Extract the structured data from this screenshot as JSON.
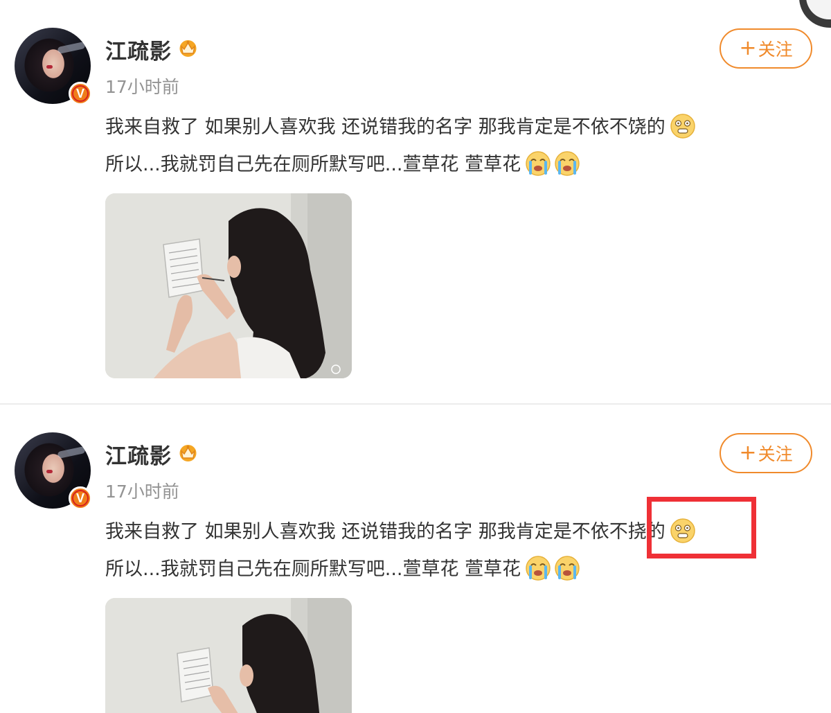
{
  "posts": [
    {
      "username": "江疏影",
      "timestamp": "17小时前",
      "follow_label": "关注",
      "follow_plus": "+",
      "verified_mark": "V",
      "text_line1": "我来自救了 如果别人喜欢我 还说错我的名字 那我肯定是不依不饶的",
      "text_line2": "所以...我就罚自己先在厕所默写吧...萱草花 萱草花",
      "emojis_line1": [
        "dizzy-face-icon"
      ],
      "emojis_line2": [
        "crying-face-icon",
        "crying-face-icon"
      ],
      "image_watermark": "weibo-logo-icon"
    },
    {
      "username": "江疏影",
      "timestamp": "17小时前",
      "follow_label": "关注",
      "follow_plus": "+",
      "verified_mark": "V",
      "text_line1_before": "我来自救了 如果别人喜欢我 还说错我的名字 那我肯定是",
      "text_line1_highlighted": "不依不挠的",
      "text_line2": "所以...我就罚自己先在厕所默写吧...萱草花 萱草花",
      "emojis_line1": [
        "dizzy-face-icon"
      ],
      "emojis_line2": [
        "crying-face-icon",
        "crying-face-icon"
      ],
      "highlight_color": "#ef3036"
    }
  ],
  "colors": {
    "follow_accent": "#f08a2b",
    "timestamp_gray": "#939393",
    "verified_orange": "#ef7d1a",
    "highlight_red": "#ef3036"
  }
}
